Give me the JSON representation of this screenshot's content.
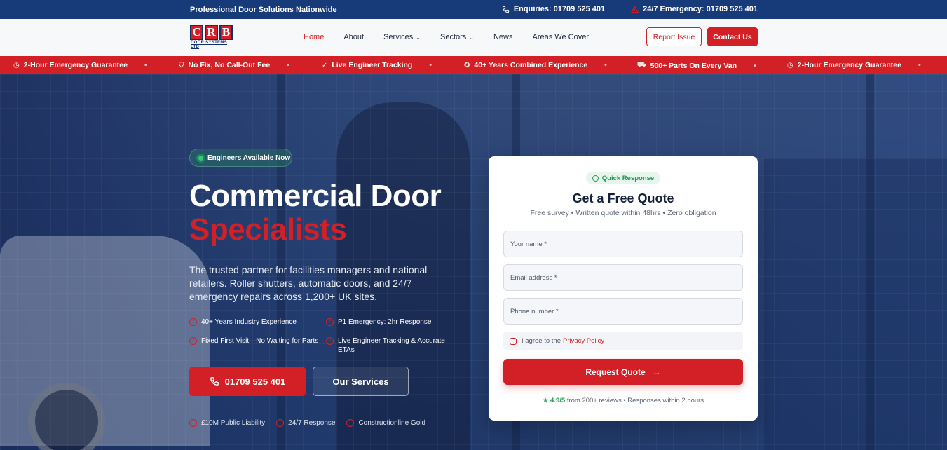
{
  "topbar": {
    "tagline": "Professional Door Solutions Nationwide",
    "enquiries": "Enquiries: 01709 525 401",
    "emergency": "24/7 Emergency: 01709 525 401"
  },
  "logo": {
    "letters": [
      "C",
      "R",
      "B"
    ],
    "sub": "DOOR SYSTEMS LTD"
  },
  "nav": {
    "items": [
      {
        "label": "Home",
        "active": true,
        "dropdown": false
      },
      {
        "label": "About",
        "dropdown": false
      },
      {
        "label": "Services",
        "dropdown": true
      },
      {
        "label": "Sectors",
        "dropdown": true
      },
      {
        "label": "News",
        "dropdown": false
      },
      {
        "label": "Areas We Cover",
        "dropdown": false
      }
    ],
    "report_issue": "Report Issue",
    "contact_us": "Contact Us"
  },
  "ticker": [
    {
      "label": "2-Hour Emergency Guarantee",
      "icon": "clock-icon"
    },
    {
      "label": "No Fix, No Call-Out Fee",
      "icon": "shield-icon"
    },
    {
      "label": "Live Engineer Tracking",
      "icon": "check-circle-icon"
    },
    {
      "label": "40+ Years Combined Experience",
      "icon": "award-icon"
    },
    {
      "label": "500+ Parts On Every Van",
      "icon": "van-icon"
    },
    {
      "label": "2-Hour Emergency Guarantee",
      "icon": "clock-icon"
    }
  ],
  "hero": {
    "badge": "Engineers Available Now",
    "title_line1": "Commercial Door",
    "title_line2": "Specialists",
    "lead": "The trusted partner for facilities managers and national retailers. Roller shutters, automatic doors, and 24/7 emergency repairs across 1,200+ UK sites.",
    "features": [
      "40+ Years Industry Experience",
      "P1 Emergency: 2hr Response",
      "Fixed First Visit—No Waiting for Parts",
      "Live Engineer Tracking & Accurate ETAs"
    ],
    "phone_cta": "01709 525 401",
    "services_cta": "Our Services",
    "trust": [
      "£10M Public Liability",
      "24/7 Response",
      "Constructionline Gold"
    ]
  },
  "quote": {
    "badge": "Quick Response",
    "title": "Get a Free Quote",
    "subtitle": "Free survey • Written quote within 48hrs • Zero obligation",
    "name_placeholder": "Your name *",
    "email_placeholder": "Email address *",
    "phone_placeholder": "Phone number *",
    "agree_text": "I agree to the",
    "privacy_link": "Privacy Policy",
    "submit": "Request Quote",
    "rating_score": "★ 4.9/5",
    "rating_text": "from 200+ reviews • Responses within 2 hours"
  },
  "colors": {
    "brand_red": "#d32026",
    "navy": "#173a78",
    "success": "#1e9b4f"
  }
}
